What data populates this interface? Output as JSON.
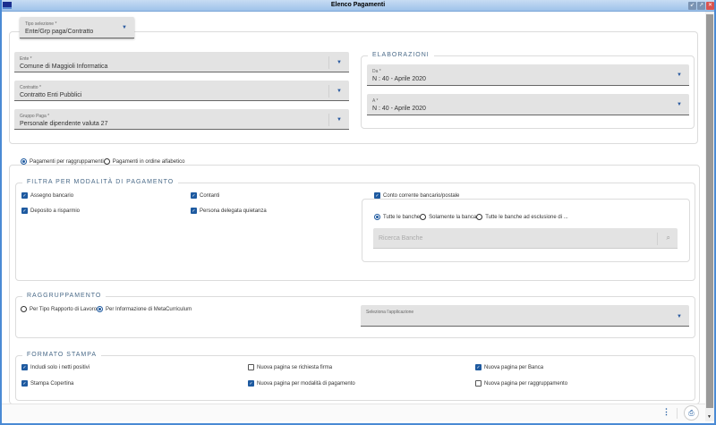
{
  "window": {
    "title": "Elenco Pagamenti"
  },
  "tipo_selezione": {
    "label": "Tipo selezione *",
    "value": "Ente/Grp paga/Contratto"
  },
  "ente": {
    "label": "Ente *",
    "value": "Comune di Maggioli Informatica"
  },
  "contratto": {
    "label": "Contratto *",
    "value": "Contratto Enti Pubblici"
  },
  "gruppo_paga": {
    "label": "Gruppo Paga *",
    "value": "Personale dipendente valuta 27"
  },
  "elaborazioni": {
    "title": "ELABORAZIONI",
    "da": {
      "label": "Da *",
      "value": "N : 40 - Aprile 2020"
    },
    "a": {
      "label": "A *",
      "value": "N : 40 - Aprile 2020"
    }
  },
  "ordine": {
    "options": [
      {
        "label": "Pagamenti per raggruppamenti",
        "selected": true
      },
      {
        "label": "Pagamenti in ordine alfabetico",
        "selected": false
      }
    ]
  },
  "filtra": {
    "title": "FILTRA PER MODALITÀ DI PAGAMENTO",
    "items": [
      {
        "label": "Assegno bancario",
        "checked": true
      },
      {
        "label": "Contanti",
        "checked": true
      },
      {
        "label": "Deposito a risparmio",
        "checked": true
      },
      {
        "label": "Persona delegata quietanza",
        "checked": true
      }
    ],
    "conto": {
      "label": "Conto corrente bancario/postale",
      "checked": true,
      "options": [
        {
          "label": "Tutte le banche",
          "selected": true
        },
        {
          "label": "Solamente la banca",
          "selected": false
        },
        {
          "label": "Tutte le banche ad esclusione di ...",
          "selected": false
        }
      ],
      "search_placeholder": "Ricerca Banche"
    }
  },
  "raggruppamento": {
    "title": "RAGGRUPPAMENTO",
    "options": [
      {
        "label": "Per Tipo Rapporto di Lavoro",
        "selected": false
      },
      {
        "label": "Per Informazione di MetaCurriculum",
        "selected": true
      }
    ],
    "applicazione": {
      "label": "Seleziona l'applicazione",
      "value": ""
    }
  },
  "formato": {
    "title": "FORMATO STAMPA",
    "items": [
      {
        "label": "Includi solo i netti positivi",
        "checked": true
      },
      {
        "label": "Nuova pagina se richiesta firma",
        "checked": false
      },
      {
        "label": "Nuova pagina per Banca",
        "checked": true
      },
      {
        "label": "Stampa Copertina",
        "checked": true
      },
      {
        "label": "Nuova pagina per modalità di pagamento",
        "checked": true
      },
      {
        "label": "Nuova pagina per raggruppamento",
        "checked": false
      }
    ]
  },
  "colors": {
    "accent": "#1e5aa0",
    "titlebar": "#9ec2ea"
  }
}
